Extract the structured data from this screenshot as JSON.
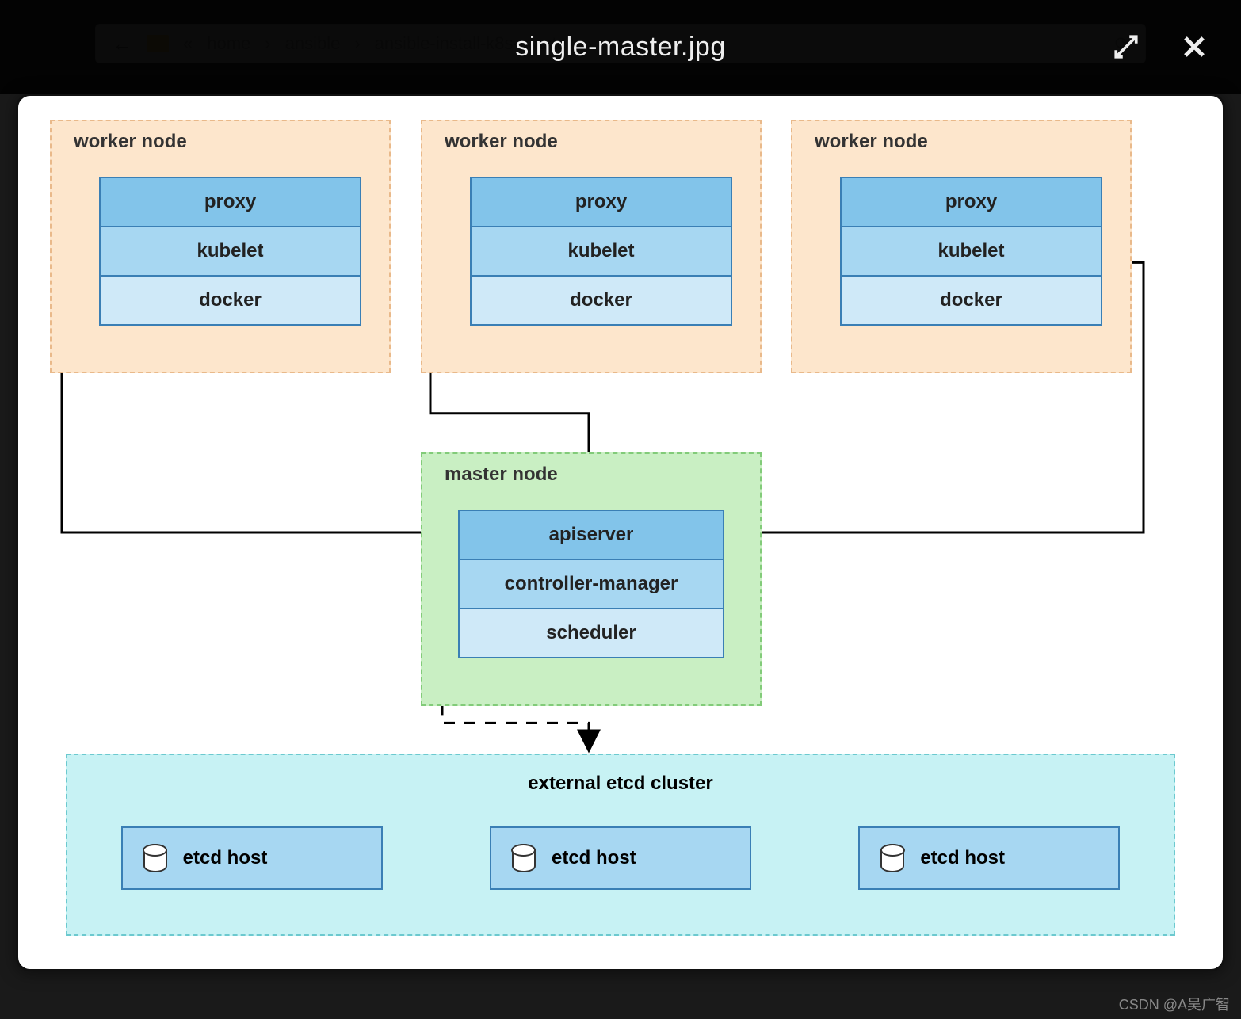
{
  "toolbar": {
    "breadcrumbs": [
      "home",
      "ansible",
      "ansible-install-k8s-master"
    ]
  },
  "titlebar": {
    "filename": "single-master.jpg"
  },
  "diagram": {
    "workers": [
      {
        "label": "worker node",
        "components": [
          "proxy",
          "kubelet",
          "docker"
        ]
      },
      {
        "label": "worker node",
        "components": [
          "proxy",
          "kubelet",
          "docker"
        ]
      },
      {
        "label": "worker node",
        "components": [
          "proxy",
          "kubelet",
          "docker"
        ]
      }
    ],
    "master": {
      "label": "master node",
      "components": [
        "apiserver",
        "controller-manager",
        "scheduler"
      ]
    },
    "etcd": {
      "label": "external etcd cluster",
      "hosts": [
        "etcd host",
        "etcd host",
        "etcd host"
      ]
    }
  },
  "watermark": "CSDN @A吴广智"
}
